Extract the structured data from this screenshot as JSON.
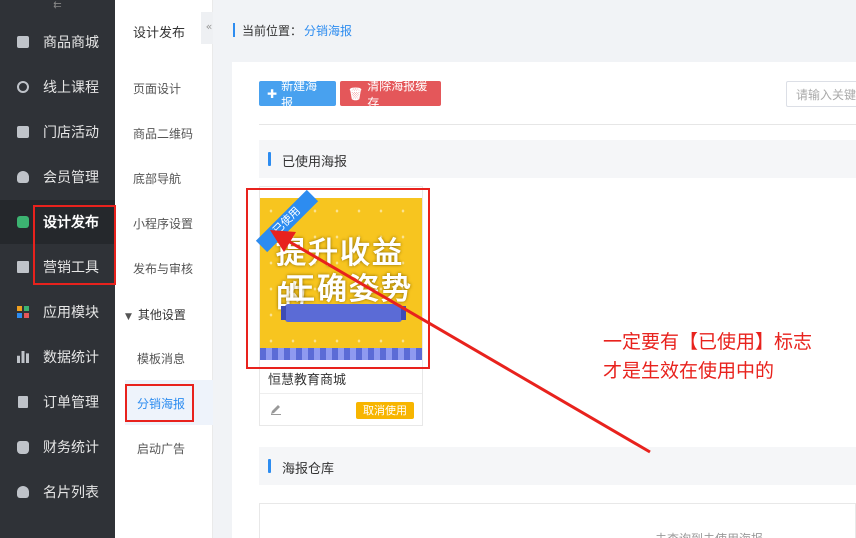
{
  "sidebar": {
    "collapse_glyph": "⇇",
    "items": [
      {
        "label": "商品商城",
        "icon": "shop-icon"
      },
      {
        "label": "线上课程",
        "icon": "course-icon"
      },
      {
        "label": "门店活动",
        "icon": "store-icon"
      },
      {
        "label": "会员管理",
        "icon": "member-icon"
      },
      {
        "label": "设计发布",
        "icon": "design-icon"
      },
      {
        "label": "营销工具",
        "icon": "gift-icon"
      },
      {
        "label": "应用模块",
        "icon": "apps-icon"
      },
      {
        "label": "数据统计",
        "icon": "chart-icon"
      },
      {
        "label": "订单管理",
        "icon": "order-icon"
      },
      {
        "label": "财务统计",
        "icon": "money-icon"
      },
      {
        "label": "名片列表",
        "icon": "card-icon"
      }
    ]
  },
  "subnav": {
    "title": "设计发布",
    "fold_glyph": "«",
    "links": [
      "页面设计",
      "商品二维码",
      "底部导航",
      "小程序设置",
      "发布与审核"
    ],
    "group_label": "其他设置",
    "group_links": [
      "模板消息",
      "分销海报",
      "启动广告"
    ]
  },
  "breadcrumb": {
    "label": "当前位置：",
    "current": "分销海报"
  },
  "toolbar": {
    "new_label": "新建海报",
    "clear_label": "清除海报缓存",
    "search_placeholder": "请输入关键"
  },
  "sections": {
    "used_title": "已使用海报",
    "warehouse_title": "海报仓库"
  },
  "poster_card": {
    "ribbon": "已使用",
    "poster_line1": "提升收益的",
    "poster_line2": "正确姿势",
    "title": "恒慧教育商城",
    "cancel_label": "取消使用"
  },
  "empty_text": "未查询到未使用海报",
  "annotation": {
    "line1": "一定要有【已使用】标志",
    "line2": "才是生效在使用中的"
  },
  "colors": {
    "accent": "#2d8cf0",
    "highlight_red": "#e8221d",
    "sidebar_bg": "#2f3237",
    "btn_blue": "#48a1ef",
    "btn_red": "#e4575a",
    "cancel_yellow": "#f7b500",
    "poster_yellow": "#f7c51f"
  }
}
